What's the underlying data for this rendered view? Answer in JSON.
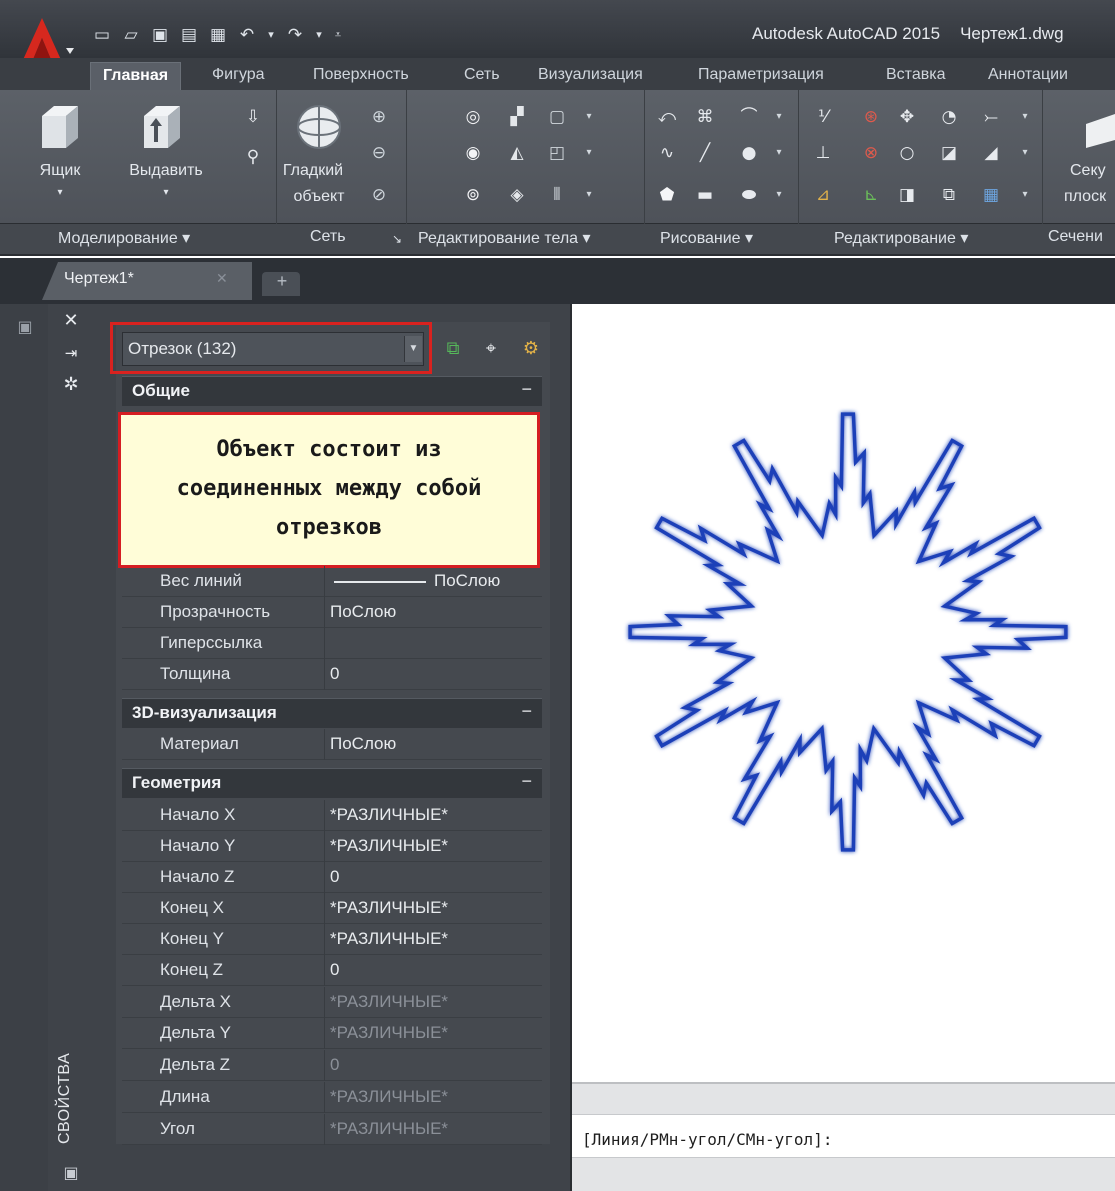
{
  "titlebar": {
    "app_title": "Autodesk AutoCAD 2015",
    "file_name": "Чертеж1.dwg",
    "qat_icons": [
      "new-icon",
      "open-icon",
      "save-icon",
      "save-as-icon",
      "plot-icon",
      "undo-icon",
      "redo-icon",
      "customize-icon"
    ]
  },
  "ribbon": {
    "tabs": [
      "Главная",
      "Фигура",
      "Поверхность",
      "Сеть",
      "Визуализация",
      "Параметризация",
      "Вставка",
      "Аннотации"
    ],
    "active_tab": "Главная",
    "buttons": {
      "box": "Ящик",
      "extrude": "Выдавить",
      "smooth_line1": "Гладкий",
      "smooth_line2": "объект",
      "section_line1": "Секу",
      "section_line2": "плоск"
    },
    "panels": [
      "Моделирование",
      "Сеть",
      "Редактирование тела",
      "Рисование",
      "Редактирование",
      "Сечени"
    ]
  },
  "document": {
    "tab_label": "Чертеж1*",
    "new_tab": "+"
  },
  "properties": {
    "selector_value": "Отрезок (132)",
    "note": [
      "Объект состоит из",
      "соединенных между собой",
      "отрезков"
    ],
    "sections": {
      "general": "Общие",
      "viz3d": "3D-визуализация",
      "geometry": "Геометрия"
    },
    "general_rows": [
      {
        "name": "Вес линий",
        "value": "ПоСлою"
      },
      {
        "name": "Прозрачность",
        "value": "ПоСлою"
      },
      {
        "name": "Гиперссылка",
        "value": ""
      },
      {
        "name": "Толщина",
        "value": "0"
      }
    ],
    "viz_rows": [
      {
        "name": "Материал",
        "value": "ПоСлою"
      }
    ],
    "geometry_rows": [
      {
        "name": "Начало X",
        "value": "*РАЗЛИЧНЫЕ*"
      },
      {
        "name": "Начало Y",
        "value": "*РАЗЛИЧНЫЕ*"
      },
      {
        "name": "Начало Z",
        "value": "0"
      },
      {
        "name": "Конец X",
        "value": "*РАЗЛИЧНЫЕ*"
      },
      {
        "name": "Конец Y",
        "value": "*РАЗЛИЧНЫЕ*"
      },
      {
        "name": "Конец Z",
        "value": "0"
      },
      {
        "name": "Дельта X",
        "value": "*РАЗЛИЧНЫЕ*"
      },
      {
        "name": "Дельта Y",
        "value": "*РАЗЛИЧНЫЕ*"
      },
      {
        "name": "Дельта Z",
        "value": "0"
      },
      {
        "name": "Длина",
        "value": "*РАЗЛИЧНЫЕ*"
      },
      {
        "name": "Угол",
        "value": "*РАЗЛИЧНЫЕ*"
      }
    ],
    "palette_label": "СВОЙСТВА"
  },
  "command": {
    "prompt": "[Линия/РМн-угол/СМн-угол]:"
  },
  "colors": {
    "accent_red": "#d51d22",
    "drawing_blue": "#1f3fb8",
    "note_bg": "#fffdd8"
  }
}
